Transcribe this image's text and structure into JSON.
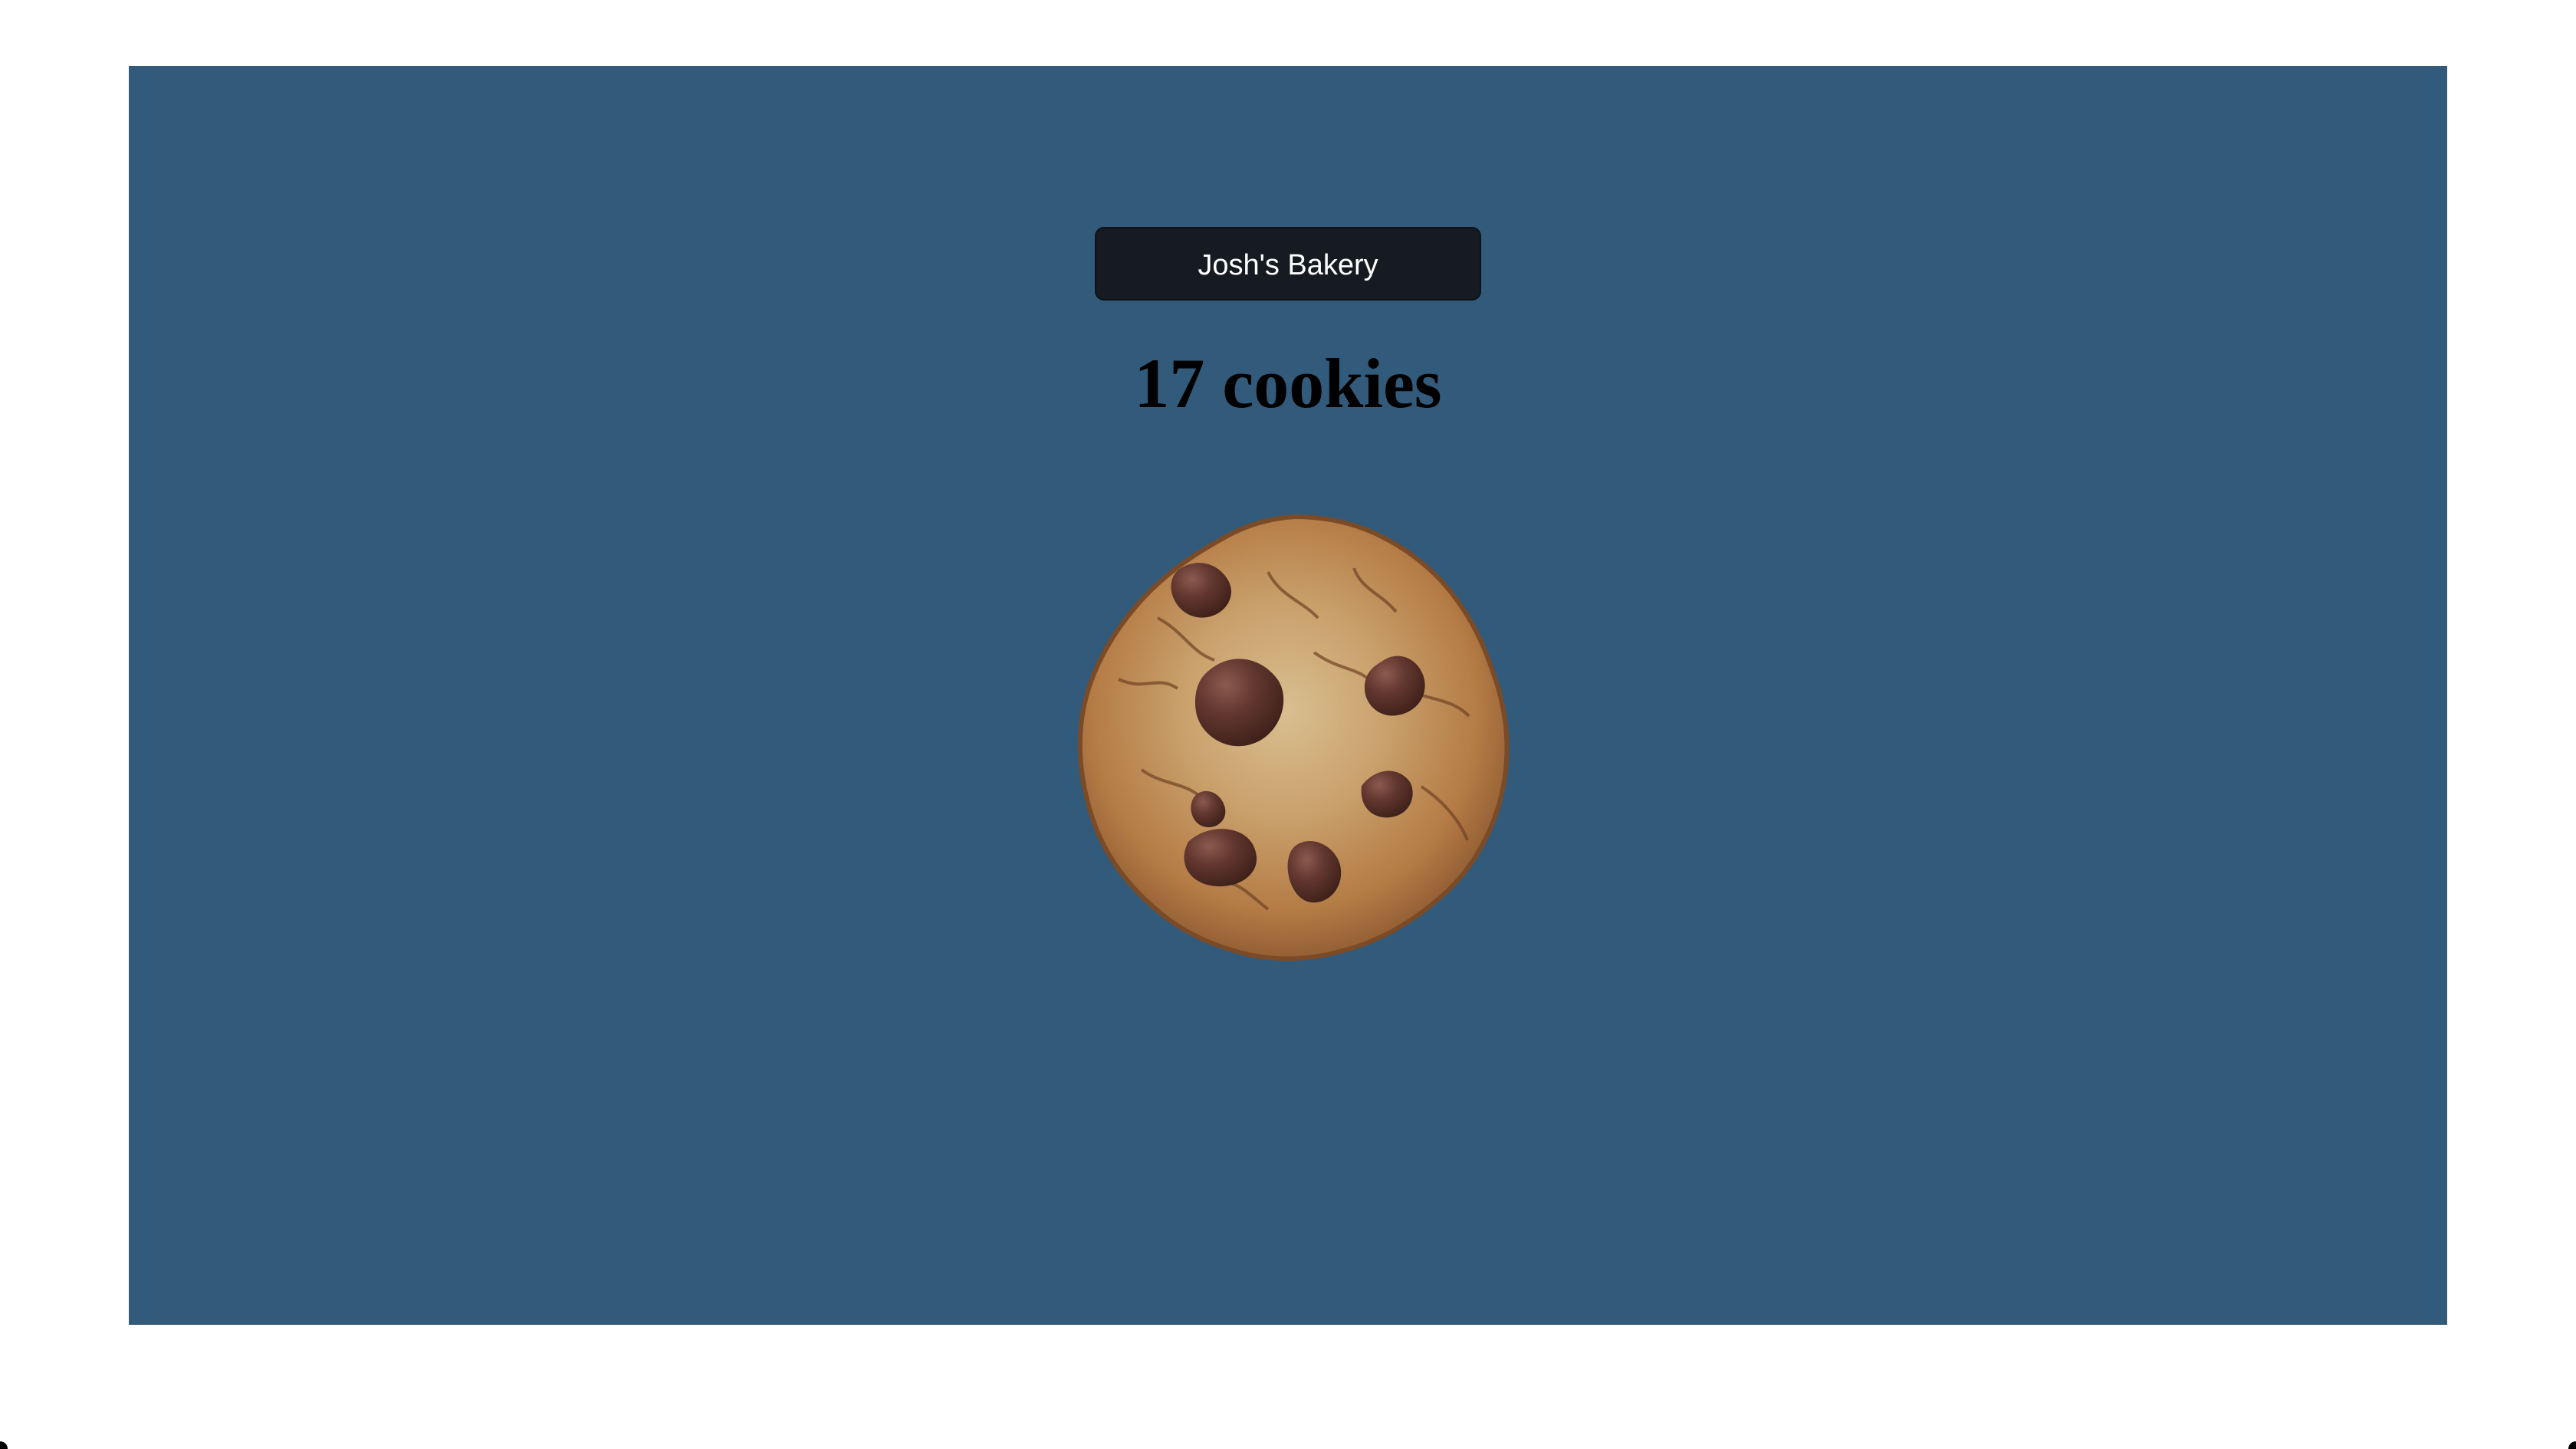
{
  "bakery": {
    "name": "Josh's Bakery",
    "cookie_count_text": "17 cookies",
    "cookie_count": 17
  },
  "icons": {
    "cookie": "chocolate-chip-cookie-icon"
  },
  "colors": {
    "stage_background": "#325a7a",
    "name_background": "#151b21",
    "name_text": "#ffffff",
    "count_text": "#000000"
  }
}
